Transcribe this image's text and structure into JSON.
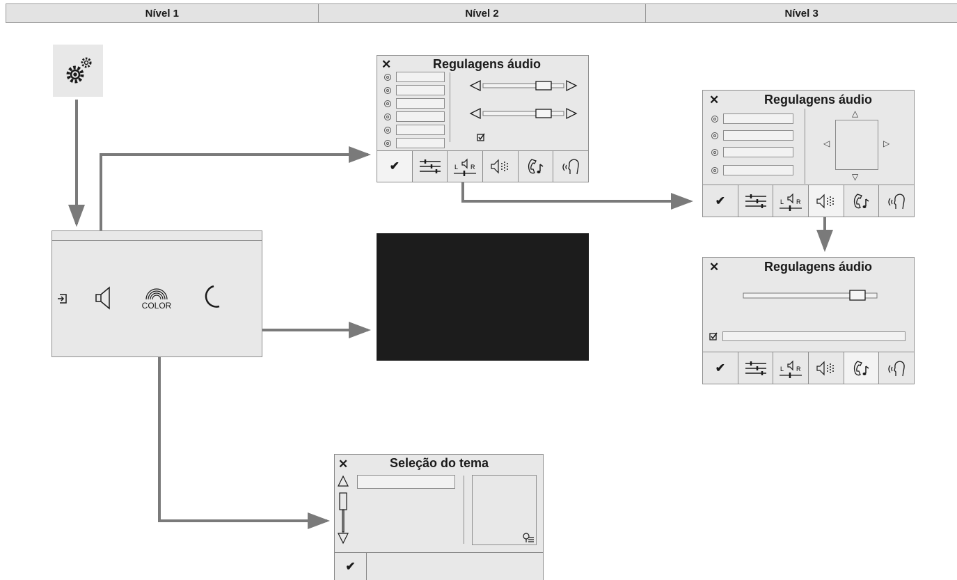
{
  "header": {
    "columns": [
      "Nível 1",
      "Nível 2",
      "Nível 3"
    ]
  },
  "panels": {
    "audio_level2": {
      "title": "Regulagens áudio",
      "close": "✕"
    },
    "audio_balance": {
      "title": "Regulagens áudio",
      "close": "✕"
    },
    "audio_ambience": {
      "title": "Regulagens áudio",
      "close": "✕"
    },
    "theme": {
      "title": "Seleção do tema",
      "close": "✕"
    }
  },
  "menu": {
    "color_label": "COLOR"
  },
  "tabbar": {
    "confirm": "✔"
  },
  "icons": {
    "settings": "gears-icon",
    "exit": "exit-icon",
    "audio": "speaker-icon",
    "color": "rainbow-color-icon",
    "night": "crescent-moon-icon",
    "tabs": [
      "check-icon",
      "equalizer-icon",
      "balance-lr-icon",
      "sound-spread-icon",
      "phone-music-icon",
      "voice-icon"
    ]
  },
  "colors": {
    "arrow": "#7a7a7a",
    "panel": "#e8e8e8",
    "screen_off": "#1c1c1c"
  }
}
